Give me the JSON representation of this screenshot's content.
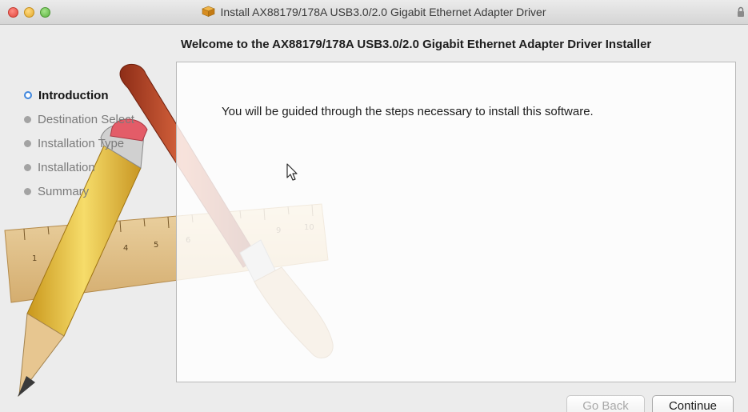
{
  "window": {
    "title": "Install AX88179/178A USB3.0/2.0 Gigabit Ethernet Adapter Driver",
    "title_icon": "package-icon",
    "lock_icon": "lock-icon"
  },
  "header": {
    "title": "Welcome to the AX88179/178A USB3.0/2.0 Gigabit Ethernet Adapter Driver Installer"
  },
  "sidebar": {
    "steps": [
      {
        "label": "Introduction",
        "active": true
      },
      {
        "label": "Destination Select",
        "active": false
      },
      {
        "label": "Installation Type",
        "active": false
      },
      {
        "label": "Installation",
        "active": false
      },
      {
        "label": "Summary",
        "active": false
      }
    ]
  },
  "main": {
    "text": "You will be guided through the steps necessary to install this software."
  },
  "buttons": {
    "back_label": "Go Back",
    "back_enabled": false,
    "continue_label": "Continue"
  },
  "ruler": {
    "tick_labels": [
      "1",
      "4",
      "5",
      "6",
      "9",
      "10"
    ]
  },
  "colors": {
    "active_step": "#3f86dd",
    "pencil": "#f2c94c",
    "brush_handle": "#b0442a"
  }
}
